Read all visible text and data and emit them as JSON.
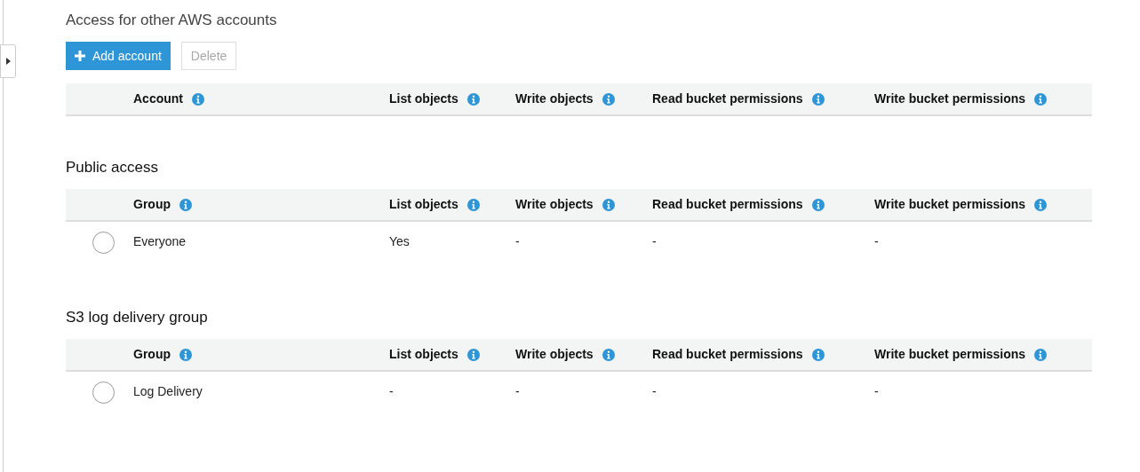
{
  "sections": [
    {
      "title": "Access for other AWS accounts",
      "buttons": [
        {
          "label": "Add account",
          "kind": "primary",
          "disabled": false
        },
        {
          "label": "Delete",
          "kind": "secondary",
          "disabled": true
        }
      ],
      "columns": [
        "Account",
        "List objects",
        "Write objects",
        "Read bucket permissions",
        "Write bucket permissions"
      ]
    },
    {
      "title": "Public access",
      "columns": [
        "Group",
        "List objects",
        "Write objects",
        "Read bucket permissions",
        "Write bucket permissions"
      ],
      "rows": [
        {
          "selected": false,
          "cells": [
            "Everyone",
            "Yes",
            "-",
            "-",
            "-"
          ]
        }
      ]
    },
    {
      "title": "S3 log delivery group",
      "columns": [
        "Group",
        "List objects",
        "Write objects",
        "Read bucket permissions",
        "Write bucket permissions"
      ],
      "rows": [
        {
          "selected": false,
          "cells": [
            "Log Delivery",
            "-",
            "-",
            "-",
            "-"
          ]
        }
      ]
    }
  ]
}
